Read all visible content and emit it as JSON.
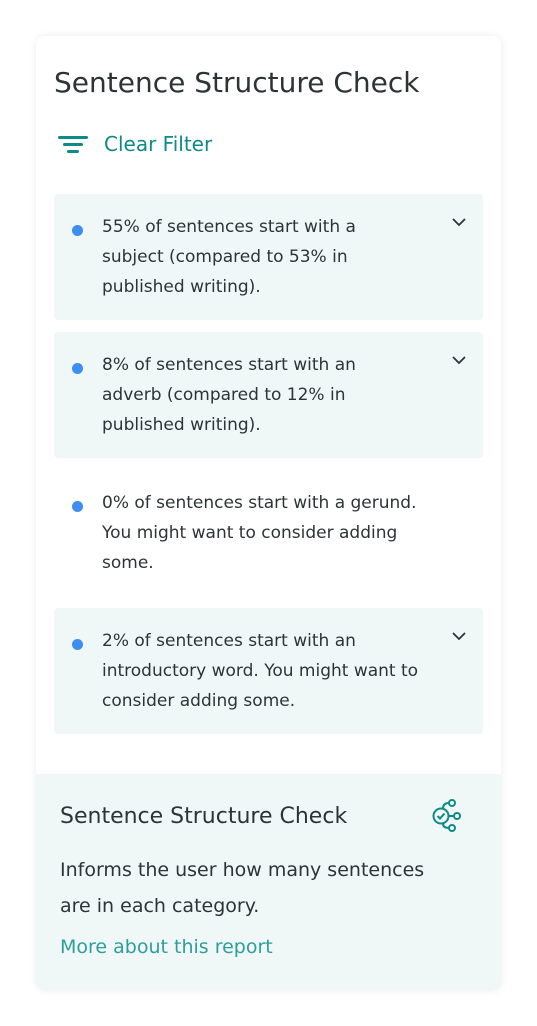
{
  "panel": {
    "title": "Sentence Structure Check",
    "clear_filter_label": "Clear Filter",
    "accent_color": "#0f8a87",
    "dot_color": "#3d8ef0"
  },
  "items": [
    {
      "text": "55% of sentences start with a subject (compared to 53% in published writing).",
      "expandable": true
    },
    {
      "text": "8% of sentences start with an adverb (compared to 12% in published writing).",
      "expandable": true
    },
    {
      "text": "0% of sentences start with a gerund. You might want to consider adding some.",
      "expandable": false
    },
    {
      "text": "2% of sentences start with an introductory word. You might want to consider adding some.",
      "expandable": true
    }
  ],
  "footer": {
    "title": "Sentence Structure Check",
    "icon": "structure-check-icon",
    "description": "Informs the user how many sentences are in each category.",
    "link_label": "More about this report"
  }
}
